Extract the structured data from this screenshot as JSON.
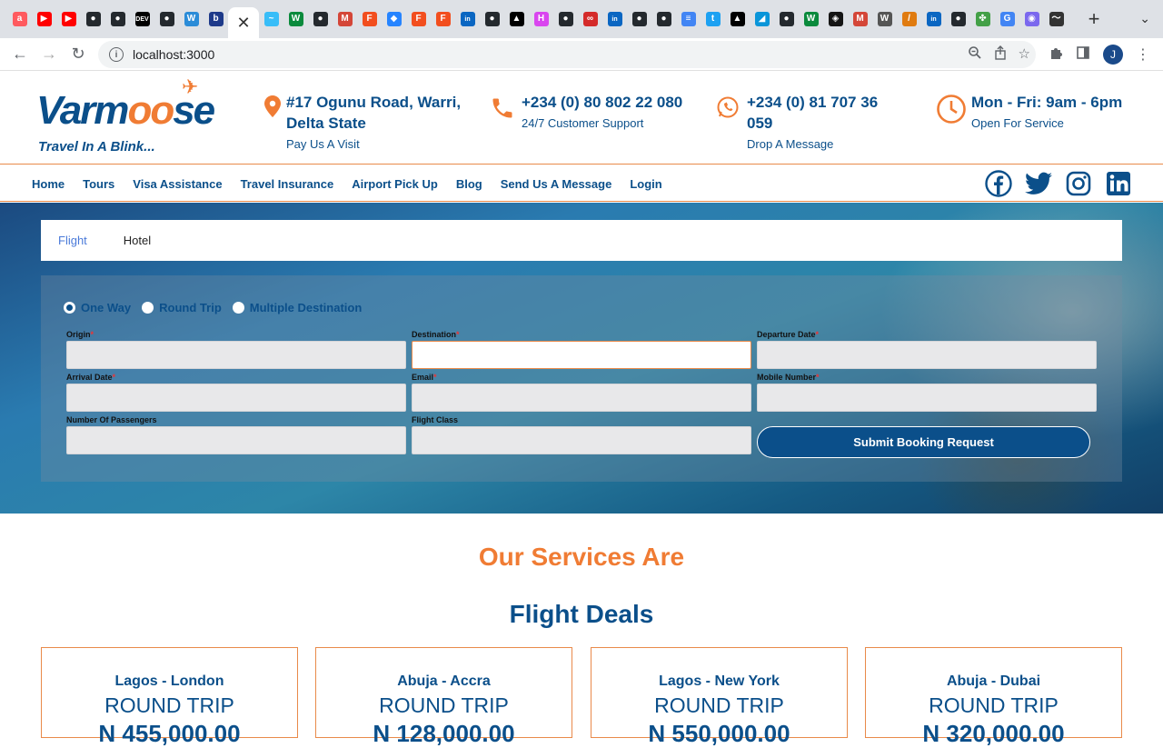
{
  "browser": {
    "tabs": [
      {
        "icon": "airbnb-icon",
        "glyph": "a",
        "color": "#ff5a5f"
      },
      {
        "icon": "youtube-icon",
        "glyph": "▶",
        "color": "#ff0000"
      },
      {
        "icon": "youtube-icon",
        "glyph": "▶",
        "color": "#ff0000"
      },
      {
        "icon": "github-icon",
        "glyph": "●",
        "color": "#24292e"
      },
      {
        "icon": "github-icon",
        "glyph": "●",
        "color": "#24292e"
      },
      {
        "icon": "dev-icon",
        "glyph": "DEV",
        "color": "#000000"
      },
      {
        "icon": "github-icon",
        "glyph": "●",
        "color": "#24292e"
      },
      {
        "icon": "webflow-icon",
        "glyph": "W",
        "color": "#2b8cd8"
      },
      {
        "icon": "bing-icon",
        "glyph": "b",
        "color": "#1e3a8a"
      },
      {
        "icon": "close-icon",
        "glyph": "✕",
        "color": "#ffffff",
        "active": true
      },
      {
        "icon": "tailwind-icon",
        "glyph": "~",
        "color": "#38bdf8"
      },
      {
        "icon": "wattpad-icon",
        "glyph": "W",
        "color": "#0a8a3c"
      },
      {
        "icon": "github-icon",
        "glyph": "●",
        "color": "#24292e"
      },
      {
        "icon": "gmail-icon",
        "glyph": "M",
        "color": "#d44638"
      },
      {
        "icon": "figma-icon",
        "glyph": "F",
        "color": "#f24e1e"
      },
      {
        "icon": "jira-icon",
        "glyph": "◆",
        "color": "#2684ff"
      },
      {
        "icon": "figma-icon",
        "glyph": "F",
        "color": "#f24e1e"
      },
      {
        "icon": "figma-icon",
        "glyph": "F",
        "color": "#f24e1e"
      },
      {
        "icon": "linkedin-icon",
        "glyph": "in",
        "color": "#0a66c2"
      },
      {
        "icon": "github-icon",
        "glyph": "●",
        "color": "#24292e"
      },
      {
        "icon": "vercel-icon",
        "glyph": "▲",
        "color": "#000000"
      },
      {
        "icon": "hashnode-icon",
        "glyph": "H",
        "color": "#d946ef"
      },
      {
        "icon": "github-icon",
        "glyph": "●",
        "color": "#24292e"
      },
      {
        "icon": "loop-icon",
        "glyph": "∞",
        "color": "#d42a2a"
      },
      {
        "icon": "linkedin-icon",
        "glyph": "in",
        "color": "#0a66c2"
      },
      {
        "icon": "github-icon",
        "glyph": "●",
        "color": "#24292e"
      },
      {
        "icon": "github-icon",
        "glyph": "●",
        "color": "#24292e"
      },
      {
        "icon": "docs-icon",
        "glyph": "≡",
        "color": "#4285f4"
      },
      {
        "icon": "twitter-icon",
        "glyph": "t",
        "color": "#1da1f2"
      },
      {
        "icon": "vercel-icon",
        "glyph": "▲",
        "color": "#000000"
      },
      {
        "icon": "maps-icon",
        "glyph": "◢",
        "color": "#0a95d9"
      },
      {
        "icon": "github-icon",
        "glyph": "●",
        "color": "#24292e"
      },
      {
        "icon": "wattpad-icon",
        "glyph": "W",
        "color": "#0a8a3c"
      },
      {
        "icon": "codesandbox-icon",
        "glyph": "◈",
        "color": "#151515"
      },
      {
        "icon": "gmail-icon",
        "glyph": "M",
        "color": "#d44638"
      },
      {
        "icon": "wikipedia-icon",
        "glyph": "W",
        "color": "#555555"
      },
      {
        "icon": "pen-icon",
        "glyph": "/",
        "color": "#e07b10"
      },
      {
        "icon": "linkedin-icon",
        "glyph": "in",
        "color": "#0a66c2"
      },
      {
        "icon": "github-icon",
        "glyph": "●",
        "color": "#24292e"
      },
      {
        "icon": "puzzle-icon",
        "glyph": "✤",
        "color": "#43a047"
      },
      {
        "icon": "google-icon",
        "glyph": "G",
        "color": "#4285f4"
      },
      {
        "icon": "brain-icon",
        "glyph": "◉",
        "color": "#7b68ee"
      },
      {
        "icon": "wave-icon",
        "glyph": "〜",
        "color": "#333333"
      }
    ],
    "url": "localhost:3000",
    "profile_initial": "J"
  },
  "header": {
    "logo": {
      "main_a": "Varm",
      "main_oo": "oo",
      "main_b": "se",
      "tagline": "Travel In A Blink..."
    },
    "address": {
      "title": "#17 Ogunu Road, Warri, Delta State",
      "sub": "Pay Us A Visit"
    },
    "phone": {
      "title": "+234 (0) 80 802 22 080",
      "sub": "24/7 Customer Support"
    },
    "whatsapp": {
      "title": "+234 (0) 81 707 36 059",
      "sub": "Drop A Message"
    },
    "hours": {
      "title": "Mon - Fri: 9am - 6pm",
      "sub": "Open For Service"
    }
  },
  "nav": {
    "items": [
      "Home",
      "Tours",
      "Visa Assistance",
      "Travel Insurance",
      "Airport Pick Up",
      "Blog",
      "Send Us A Message",
      "Login"
    ],
    "social": [
      "facebook-icon",
      "twitter-icon",
      "instagram-icon",
      "linkedin-icon"
    ]
  },
  "booking": {
    "tabs": {
      "flight": "Flight",
      "hotel": "Hotel"
    },
    "trip_types": {
      "one_way": "One Way",
      "round_trip": "Round Trip",
      "multi": "Multiple Destination"
    },
    "fields": {
      "origin": "Origin",
      "destination": "Destination",
      "departure": "Departure Date",
      "arrival": "Arrival Date",
      "email": "Email",
      "mobile": "Mobile Number",
      "passengers": "Number Of Passengers",
      "flight_class": "Flight Class"
    },
    "submit": "Submit Booking Request"
  },
  "sections": {
    "services_title": "Our Services Are",
    "deals_title": "Flight Deals"
  },
  "deals": [
    {
      "route": "Lagos - London",
      "trip": "ROUND TRIP",
      "price": "N 455,000.00"
    },
    {
      "route": "Abuja - Accra",
      "trip": "ROUND TRIP",
      "price": "N 128,000.00"
    },
    {
      "route": "Lagos - New York",
      "trip": "ROUND TRIP",
      "price": "N 550,000.00"
    },
    {
      "route": "Abuja - Dubai",
      "trip": "ROUND TRIP",
      "price": "N 320,000.00"
    }
  ],
  "colors": {
    "brand_blue": "#0b4f8a",
    "brand_orange": "#f07c34"
  }
}
